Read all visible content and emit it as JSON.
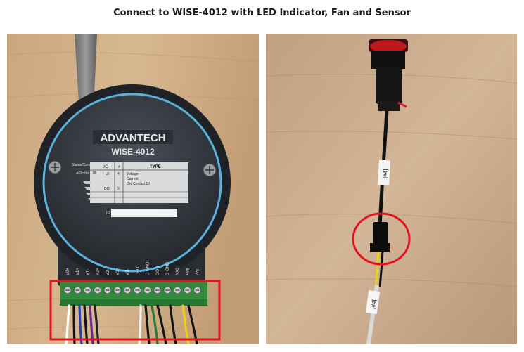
{
  "header": {
    "title": "Connect to WISE-4012 with LED Indicator, Fan and Sensor"
  },
  "left_photo": {
    "brand": "ADVANTECH",
    "model": "WISE-4012",
    "status_labels": [
      "Status/Com",
      "AP/Infra"
    ],
    "table_headers": [
      "I/O",
      "#",
      "TYPE"
    ],
    "table_rows": [
      [
        "UI",
        "4",
        "Voltage"
      ],
      [
        "",
        "",
        "Current"
      ],
      [
        "",
        "",
        "Dry Contact DI"
      ],
      [
        "DO",
        "2",
        ""
      ]
    ],
    "ip_label": "IP",
    "terminal_labels": [
      "V0+",
      "V1+",
      "V1-",
      "V2+",
      "V2-",
      "V3+",
      "V3-",
      "DO 0",
      "D GND",
      "DO 1",
      "D GND",
      "N/C",
      "+Vs",
      "-Vs"
    ],
    "highlight_color": "#e3121c"
  },
  "right_photo": {
    "cable_tags": [
      "[#4]",
      "[#4]"
    ],
    "highlight_color": "#e3121c"
  }
}
